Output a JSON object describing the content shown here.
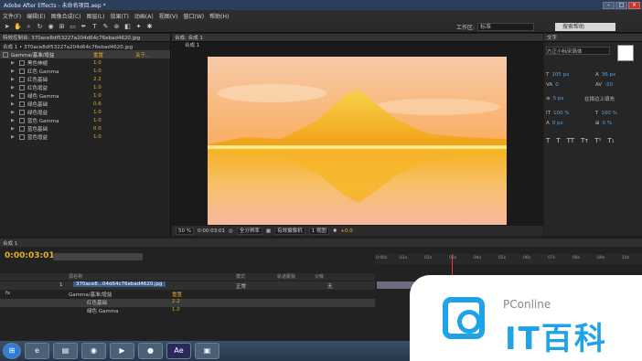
{
  "app": {
    "title": "Adobe After Effects - 未命名项目.aep *"
  },
  "menu": [
    "文件(F)",
    "编辑(E)",
    "图像合成(C)",
    "图层(L)",
    "效果(T)",
    "动画(A)",
    "视图(V)",
    "窗口(W)",
    "帮助(H)"
  ],
  "toolbar": {
    "workspace_label": "工作区:",
    "workspace_value": "标准",
    "search_placeholder": "搜索帮助"
  },
  "effects_panel": {
    "tab": "特效控制台: 370ace8df53227a204d64c76ebad4620.jpg",
    "layer_line": "合成 1 • 370ace8df53227a204d64c76ebad4620.jpg",
    "effect_name": "Gamma/基准/增益",
    "reset": "重置",
    "about": "关于...",
    "rows": [
      {
        "name": "黑色伸缩",
        "value": "1.0"
      },
      {
        "name": "红色 Gamma",
        "value": "1.0"
      },
      {
        "name": "红色基础",
        "value": "2.2"
      },
      {
        "name": "红色增益",
        "value": "1.0"
      },
      {
        "name": "绿色 Gamma",
        "value": "1.0"
      },
      {
        "name": "绿色基础",
        "value": "0.6"
      },
      {
        "name": "绿色增益",
        "value": "1.0"
      },
      {
        "name": "蓝色 Gamma",
        "value": "1.0"
      },
      {
        "name": "蓝色基础",
        "value": "0.0"
      },
      {
        "name": "蓝色增益",
        "value": "1.0"
      }
    ]
  },
  "viewer": {
    "tab": "合成: 合成 1",
    "sub": "合成 1",
    "zoom": "50 %",
    "time": "0:00:03:01",
    "resolution": "全分辨率",
    "camera": "有效摄像机",
    "views": "1 视图",
    "exposure": "+0.0"
  },
  "character_panel": {
    "tab": "文字",
    "font": "方正小标宋简体",
    "size": "105 px",
    "leading": "36 px",
    "kerning": "0",
    "tracking": "-50",
    "stroke": "5 px",
    "stroke_mode": "在描边上填充",
    "vscale": "100 %",
    "hscale": "100 %",
    "baseline": "0 px",
    "tsume": "0 %"
  },
  "timeline": {
    "tab": "合成 1",
    "timecode": "0:00:03:01",
    "ruler": [
      "0:00s",
      "01s",
      "02s",
      "03s",
      "04s",
      "05s",
      "06s",
      "07s",
      "08s",
      "09s",
      "10s"
    ],
    "col_source": "源名称",
    "col_mode": "模式",
    "col_trkmat": "轨道蒙版",
    "col_parent": "父级",
    "layer": {
      "index": "1",
      "name": "370ace8...04d64c76ebad4620.jpg",
      "mode": "正常",
      "parent": "无"
    },
    "effect": "Gamma/基准/增益",
    "effect_reset": "重置",
    "props": [
      {
        "name": "红色基础",
        "value": "2.2"
      },
      {
        "name": "绿色 Gamma",
        "value": "1.0"
      }
    ]
  },
  "watermark": {
    "brand": "PConline",
    "text": "IT百科"
  },
  "colors": {
    "accent": "#e8b12c",
    "blue": "#1fa2e8"
  }
}
